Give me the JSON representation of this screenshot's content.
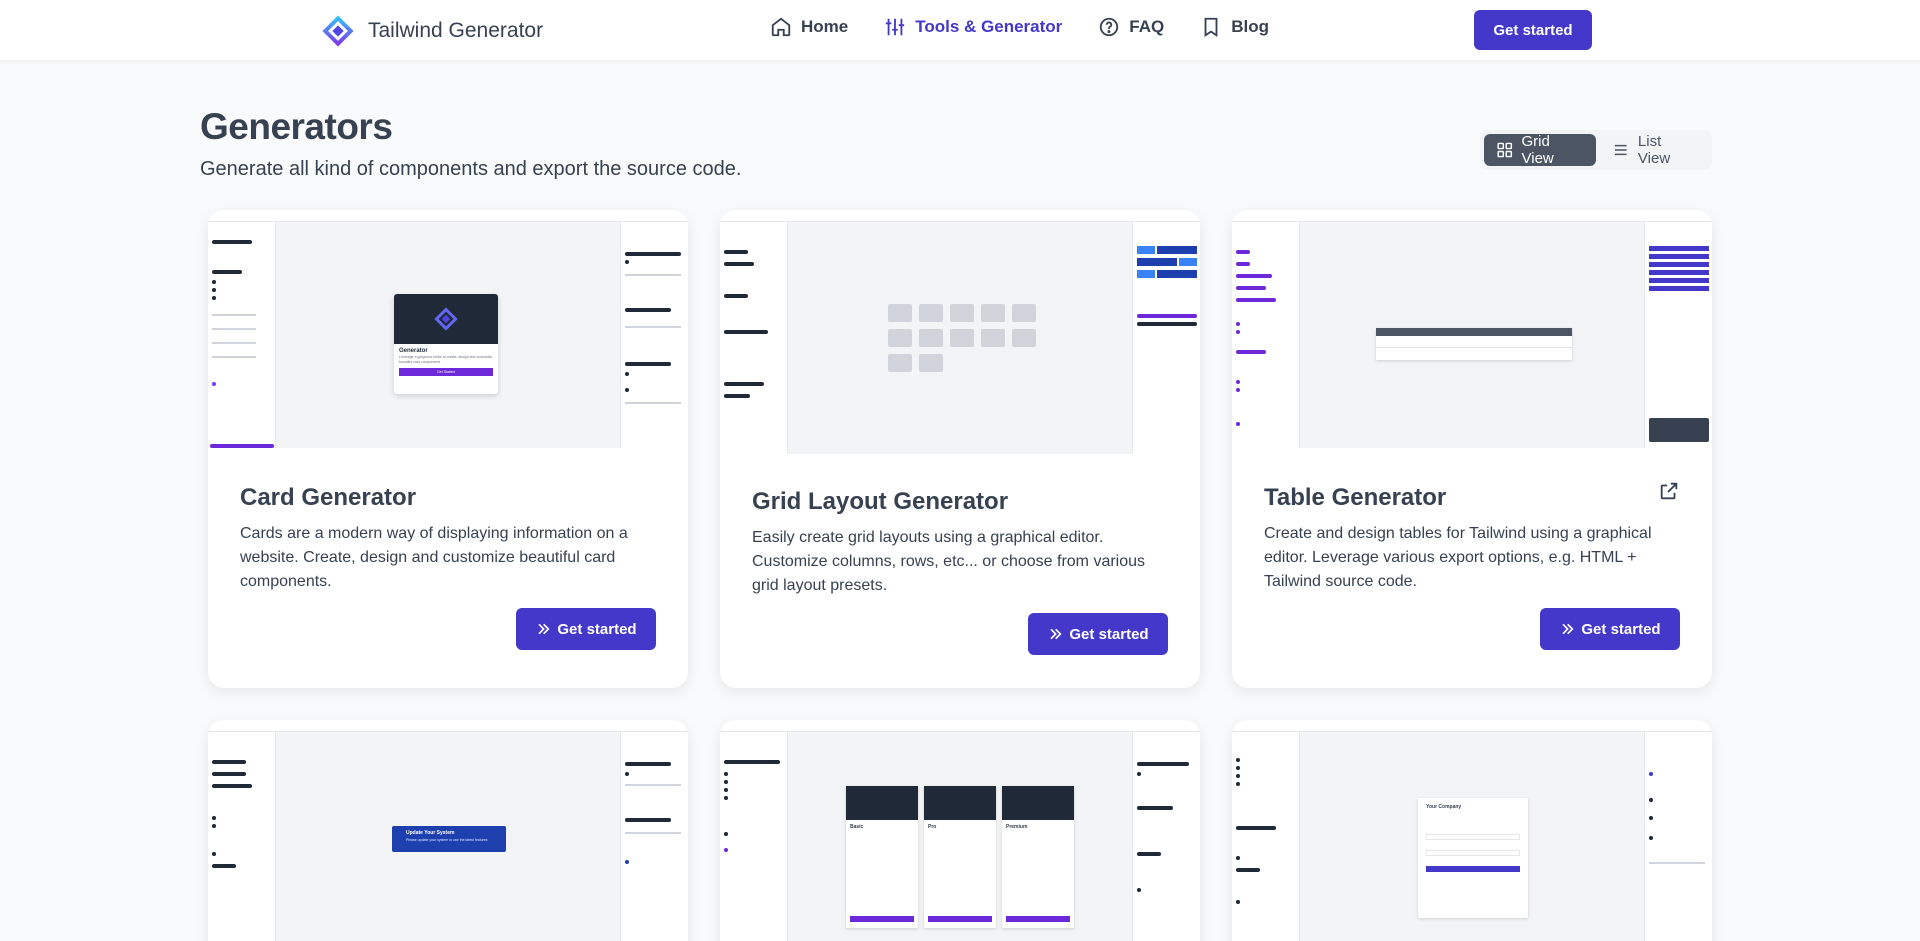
{
  "header": {
    "brand_name": "Tailwind Generator",
    "nav": [
      {
        "label": "Home",
        "icon": "home-icon"
      },
      {
        "label": "Tools & Generator",
        "icon": "sliders-icon",
        "active": true
      },
      {
        "label": "FAQ",
        "icon": "question-icon"
      },
      {
        "label": "Blog",
        "icon": "bookmark-icon"
      }
    ],
    "cta_label": "Get started",
    "accent_color": "#4338ca"
  },
  "main": {
    "title": "Generators",
    "subtitle": "Generate all kind of components and export the source code.",
    "view_toggle": {
      "grid_label": "Grid View",
      "list_label": "List View",
      "selected": "Grid View"
    }
  },
  "cards": [
    {
      "title": "Card Generator",
      "description": "Cards are a modern way of displaying information on a website. Create, design and customize beautiful card components.",
      "cta_label": "Get started",
      "preview": {
        "title": "Generator",
        "text": "Leverage a gorgeous editor to create, design and customize beautiful card components.",
        "button": "Get Started"
      }
    },
    {
      "title": "Grid Layout Generator",
      "description": "Easily create grid layouts using a graphical editor. Customize columns, rows, etc... or choose from various grid layout presets.",
      "cta_label": "Get started"
    },
    {
      "title": "Table Generator",
      "description": "Create and design tables for Tailwind using a graphical editor. Leverage various export options, e.g. HTML + Tailwind source code.",
      "cta_label": "Get started",
      "external_icon": "external-link-icon"
    }
  ],
  "row2_previews": [
    {
      "alert_title": "Update Your System",
      "alert_text": "Please update your system to use the latest features"
    },
    {
      "tiers": [
        "Basic",
        "Pro",
        "Premium"
      ]
    },
    {
      "login_brand": "Your Company"
    }
  ]
}
